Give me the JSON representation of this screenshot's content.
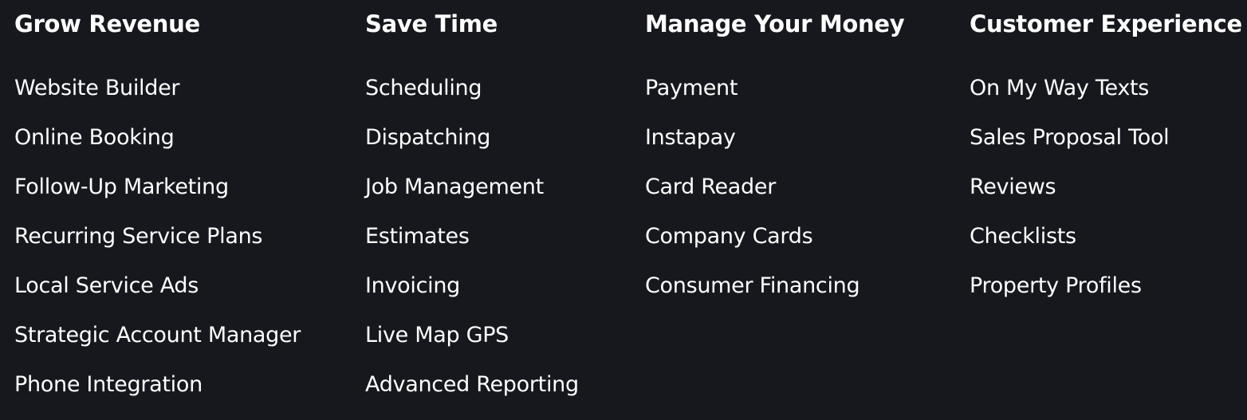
{
  "columns": [
    {
      "heading": "Grow Revenue",
      "links": [
        "Website Builder",
        "Online Booking",
        "Follow-Up Marketing",
        "Recurring Service Plans",
        "Local Service Ads",
        "Strategic Account Manager",
        "Phone Integration"
      ]
    },
    {
      "heading": "Save Time",
      "links": [
        "Scheduling",
        "Dispatching",
        "Job Management",
        "Estimates",
        "Invoicing",
        "Live Map GPS",
        "Advanced Reporting"
      ]
    },
    {
      "heading": "Manage Your Money",
      "links": [
        "Payment",
        "Instapay",
        "Card Reader",
        "Company Cards",
        "Consumer Financing"
      ]
    },
    {
      "heading": "Customer Experience",
      "links": [
        "On My Way Texts",
        "Sales Proposal Tool",
        "Reviews",
        "Checklists",
        "Property Profiles"
      ]
    }
  ]
}
